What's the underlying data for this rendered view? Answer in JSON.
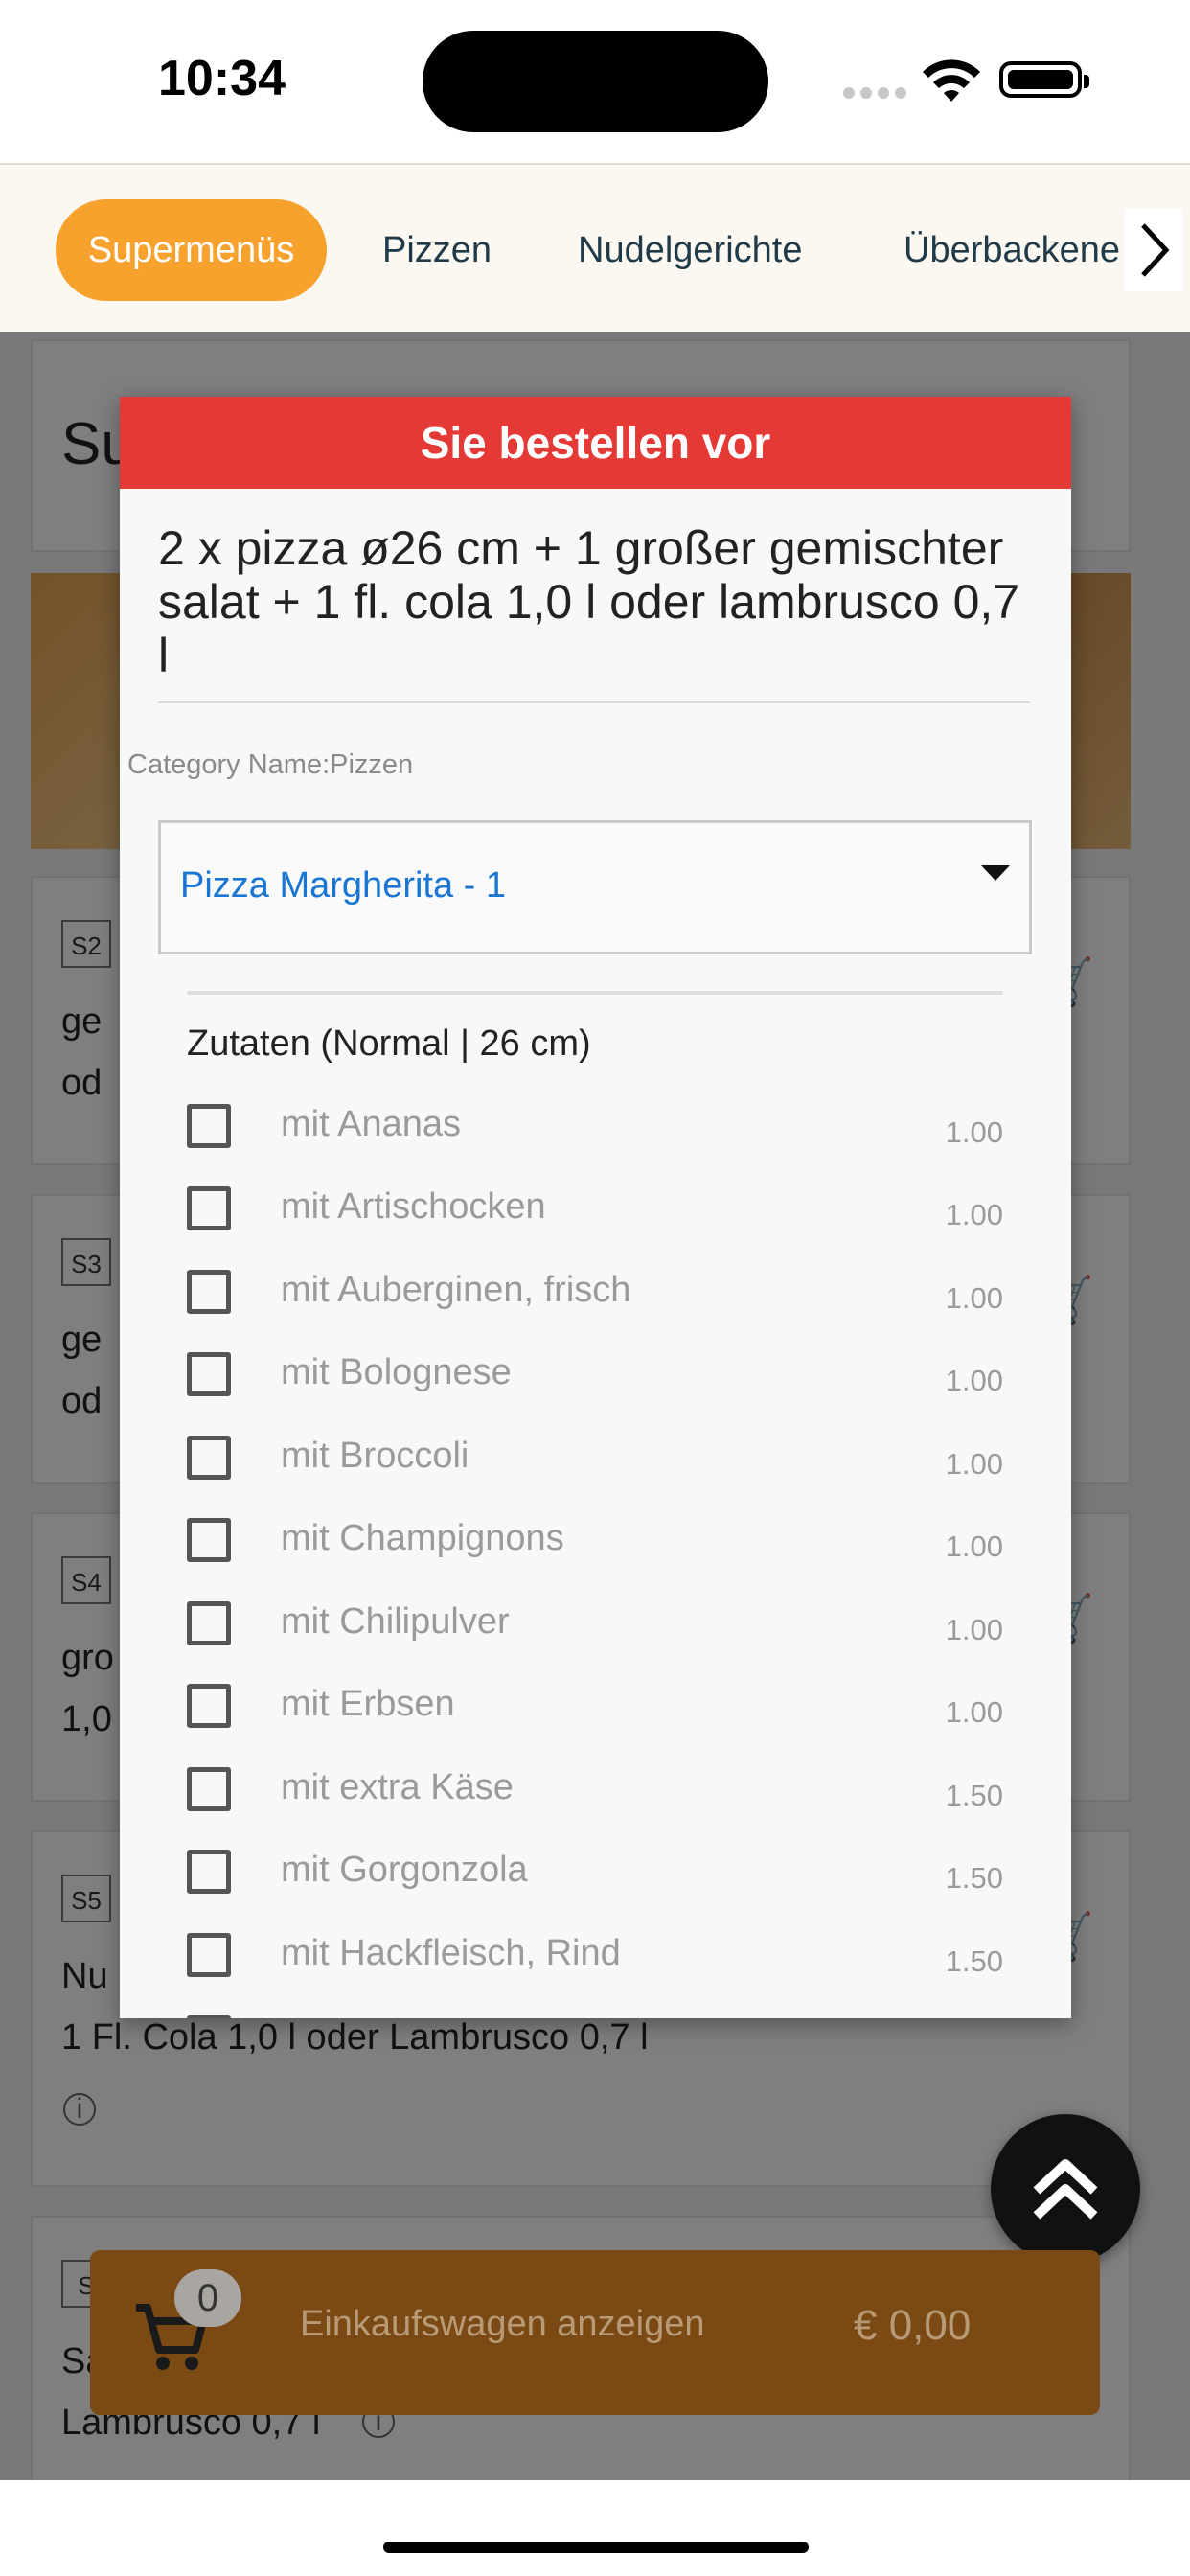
{
  "status": {
    "time": "10:34"
  },
  "tabs": {
    "items": [
      "Supermenüs",
      "Pizzen",
      "Nudelgerichte",
      "Überbackene"
    ]
  },
  "background": {
    "heading": "Su",
    "cards": [
      {
        "code": "S2",
        "line1": "ge",
        "line2": "od"
      },
      {
        "code": "S3",
        "line1": "ge",
        "line2": "od"
      },
      {
        "code": "S4",
        "line1": "gro",
        "line2": "1,0"
      },
      {
        "code": "S5",
        "line1": "Nu",
        "line2": "1 Fl. Cola 1,0 l oder Lambrusco 0,7 l"
      },
      {
        "code": "S",
        "line1": "Sa",
        "line2": "Lambrusco 0,7 l"
      }
    ]
  },
  "modal": {
    "header": "Sie bestellen vor",
    "title": "2 x pizza ø26 cm + 1 großer gemischter salat + 1 fl. cola 1,0 l oder lambrusco 0,7 l",
    "category": "Category Name:Pizzen",
    "select_value": "Pizza Margherita - 1",
    "zutaten_label": "Zutaten (Normal | 26 cm)",
    "options": [
      {
        "label": "mit Ananas",
        "price": "1.00"
      },
      {
        "label": "mit Artischocken",
        "price": "1.00"
      },
      {
        "label": "mit Auberginen, frisch",
        "price": "1.00"
      },
      {
        "label": "mit Bolognese",
        "price": "1.00"
      },
      {
        "label": "mit Broccoli",
        "price": "1.00"
      },
      {
        "label": "mit Champignons",
        "price": "1.00"
      },
      {
        "label": "mit Chilipulver",
        "price": "1.00"
      },
      {
        "label": "mit Erbsen",
        "price": "1.00"
      },
      {
        "label": "mit extra Käse",
        "price": "1.50"
      },
      {
        "label": "mit Gorgonzola",
        "price": "1.50"
      },
      {
        "label": "mit Hackfleisch, Rind",
        "price": "1.50"
      }
    ]
  },
  "cart": {
    "count": "0",
    "label": "Einkaufswagen anzeigen",
    "total": "€ 0,00"
  },
  "colors": {
    "accent": "#f7a22d",
    "modal_header": "#e53935",
    "link": "#1976d2"
  }
}
